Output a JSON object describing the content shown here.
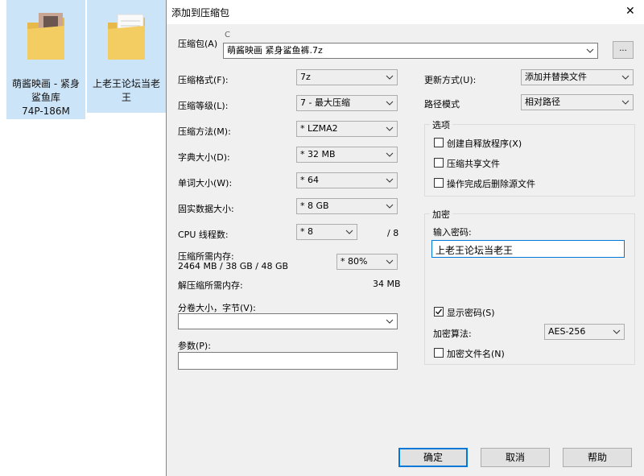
{
  "desktop": {
    "items": [
      {
        "label_line1": "萌酱映画 - 紧身",
        "label_line2": "鲨鱼库",
        "label_line3": "74P-186M"
      },
      {
        "label_line1": "上老王论坛当老",
        "label_line2": "王"
      }
    ]
  },
  "dialog": {
    "title": "添加到压缩包",
    "close_glyph": "✕",
    "archive_label": "压缩包(A)",
    "archive_path_partial": "C",
    "archive_name": "萌酱映画 紧身鲨鱼裤.7z",
    "browse_label": "...",
    "format_label": "压缩格式(F):",
    "format_value": "7z",
    "level_label": "压缩等级(L):",
    "level_value": "7 - 最大压缩",
    "method_label": "压缩方法(M):",
    "method_value": "* LZMA2",
    "dict_label": "字典大小(D):",
    "dict_value": "* 32 MB",
    "word_label": "单词大小(W):",
    "word_value": "* 64",
    "solid_label": "固实数据大小:",
    "solid_value": "* 8 GB",
    "cpu_label": "CPU 线程数:",
    "cpu_value": "* 8",
    "cpu_max": "/ 8",
    "mem_label": "压缩所需内存:",
    "mem_detail": "2464 MB / 38 GB / 48 GB",
    "mem_value": "* 80%",
    "decomp_label": "解压缩所需内存:",
    "decomp_value": "34 MB",
    "split_label": "分卷大小，字节(V):",
    "split_value": "",
    "params_label": "参数(P):",
    "params_value": "",
    "update_label": "更新方式(U):",
    "update_value": "添加并替换文件",
    "path_label": "路径模式",
    "path_value": "相对路径",
    "options_title": "选项",
    "opt_sfx": "创建自释放程序(X)",
    "opt_shared": "压缩共享文件",
    "opt_delete": "操作完成后删除源文件",
    "encrypt_title": "加密",
    "pwd_label": "输入密码:",
    "pwd_value": "上老王论坛当老王",
    "show_pwd": "显示密码(S)",
    "algo_label": "加密算法:",
    "algo_value": "AES-256",
    "encrypt_names": "加密文件名(N)",
    "ok": "确定",
    "cancel": "取消",
    "help": "帮助"
  }
}
